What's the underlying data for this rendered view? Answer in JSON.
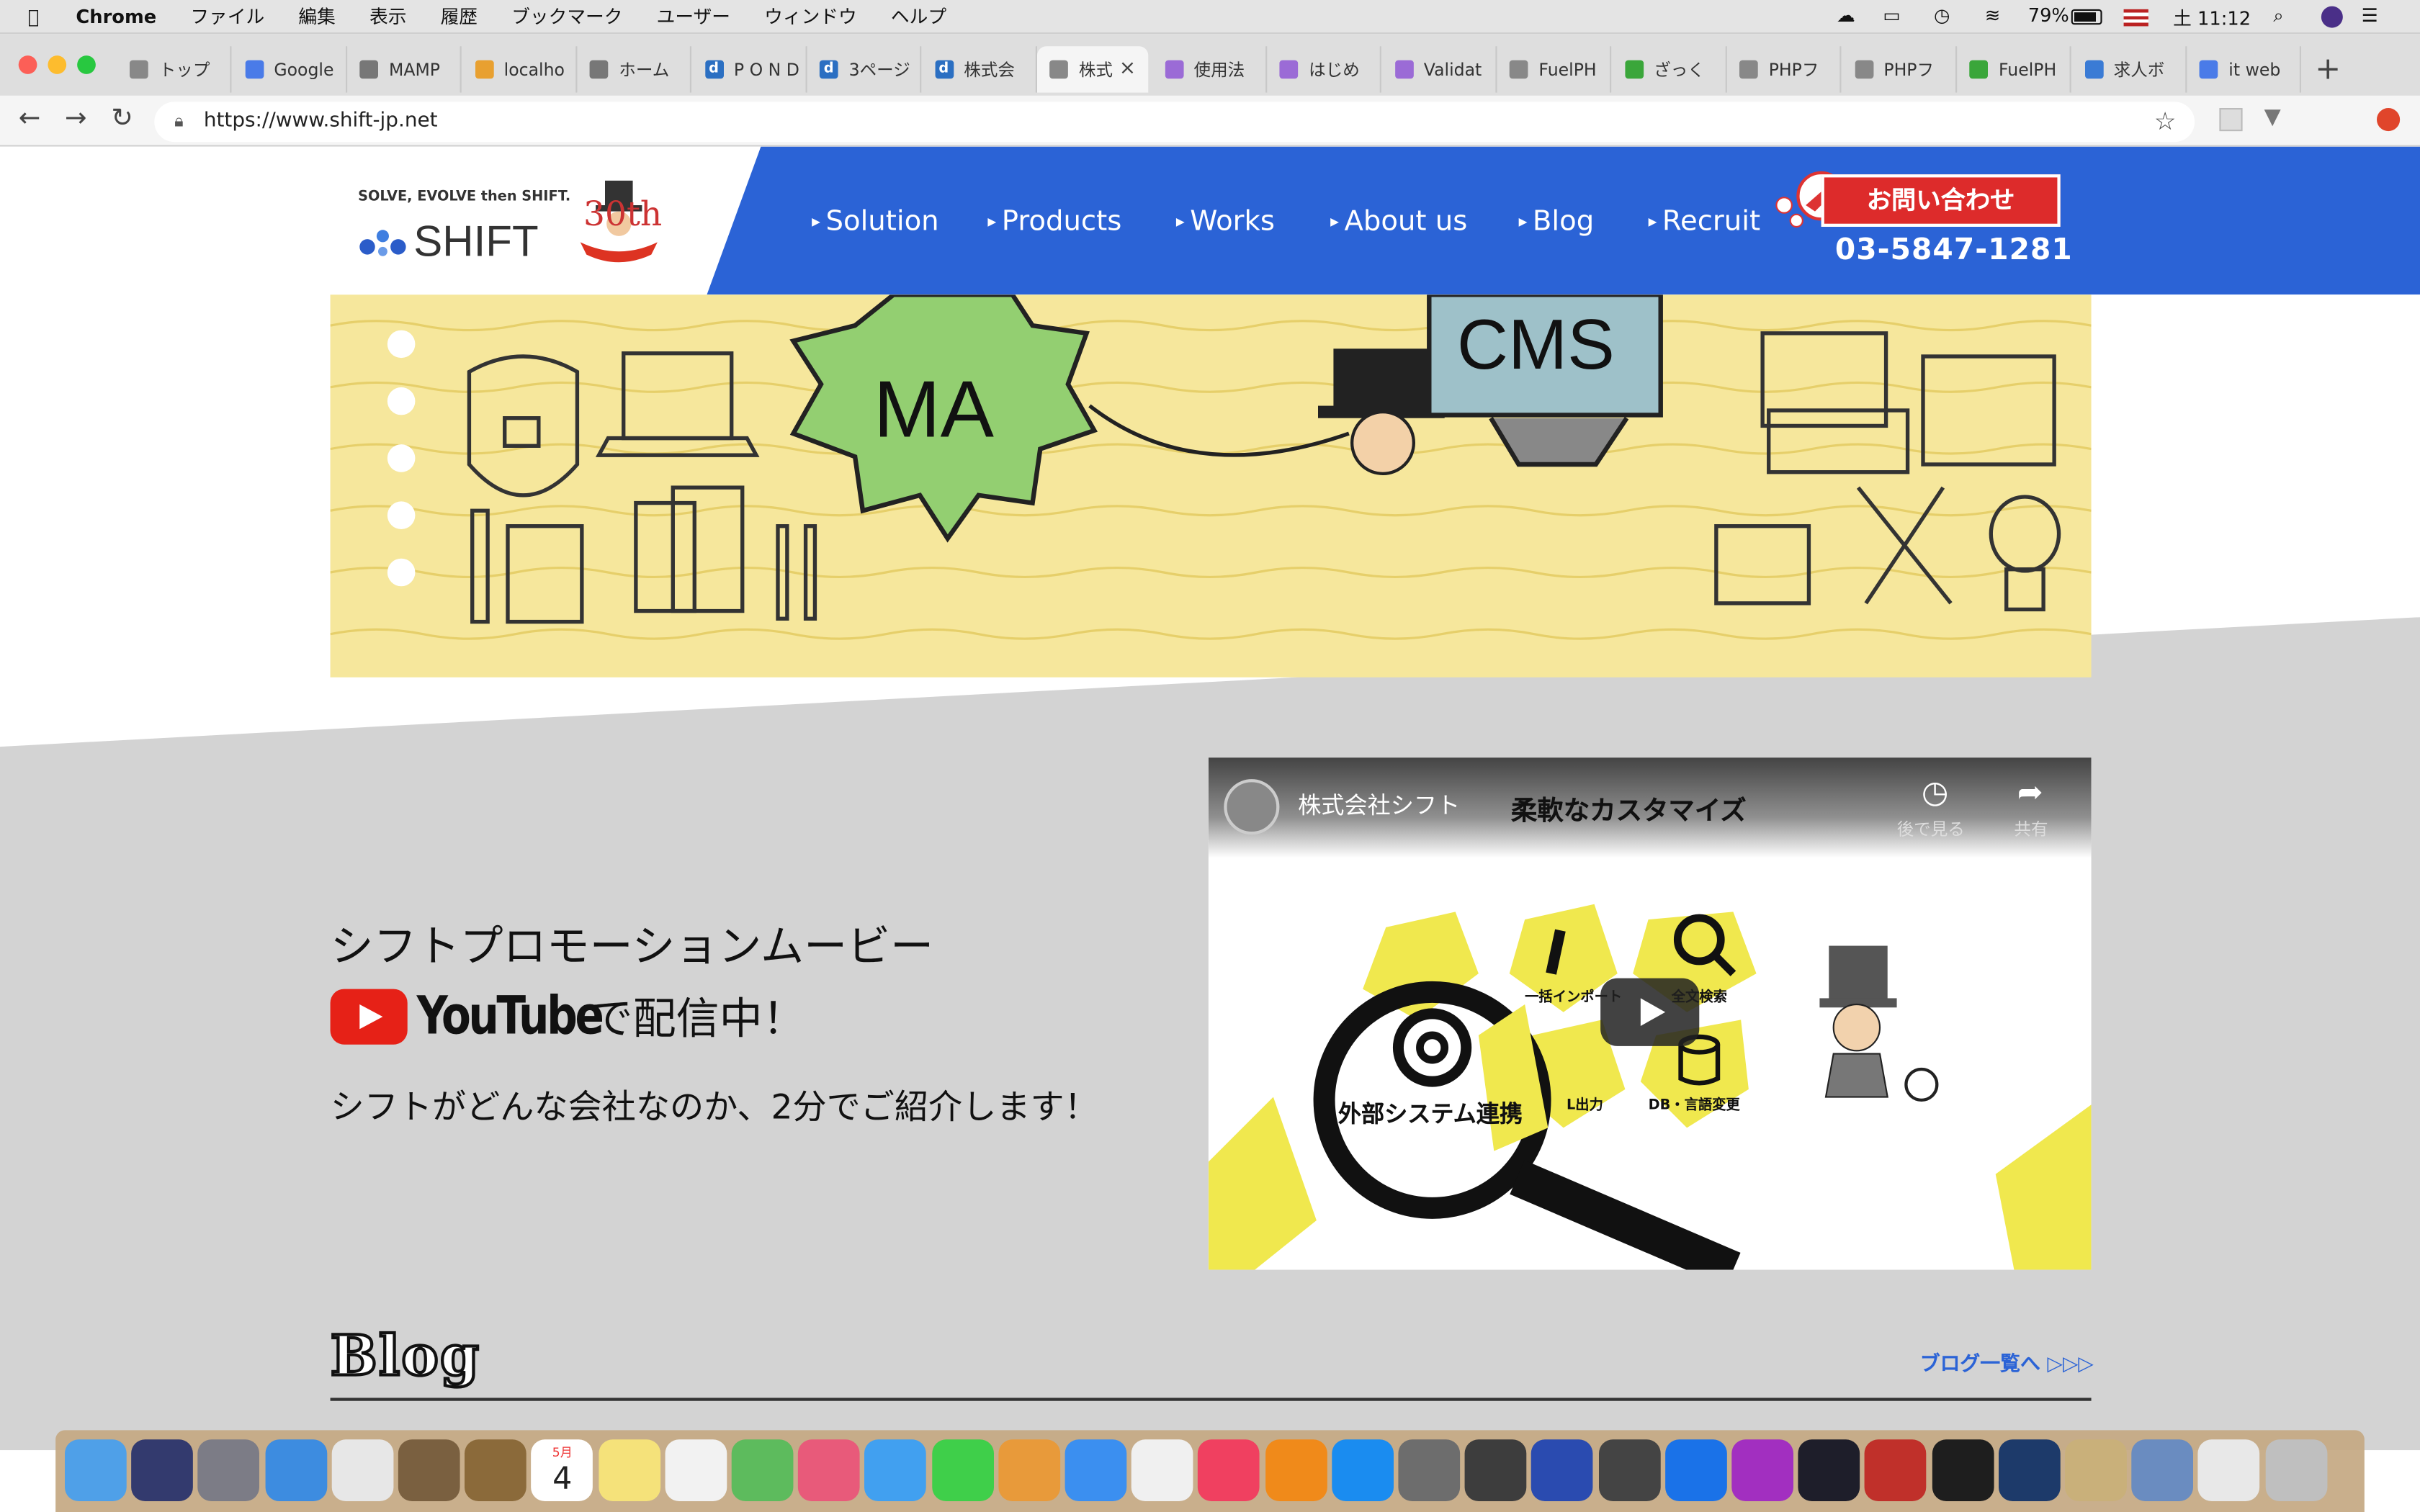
{
  "menubar": {
    "app": "Chrome",
    "items": [
      "ファイル",
      "編集",
      "表示",
      "履歴",
      "ブックマーク",
      "ユーザー",
      "ウィンドウ",
      "ヘルプ"
    ],
    "battery": "79%",
    "clock": "土 11:12"
  },
  "tabs": [
    {
      "label": "トップ",
      "fav": "doc",
      "color": "#888"
    },
    {
      "label": "Google",
      "fav": "G",
      "color": "#4a7be8"
    },
    {
      "label": "MAMP",
      "fav": "M",
      "color": "#777"
    },
    {
      "label": "localho",
      "fav": "pma",
      "color": "#e8a030"
    },
    {
      "label": "ホーム",
      "fav": "M",
      "color": "#777"
    },
    {
      "label": "P O N D",
      "fav": "d",
      "color": "#2b6fc2"
    },
    {
      "label": "3ページ",
      "fav": "d",
      "color": "#2b6fc2"
    },
    {
      "label": "株式会",
      "fav": "d",
      "color": "#2b6fc2"
    },
    {
      "label": "株式",
      "fav": "doc",
      "color": "#888",
      "active": true
    },
    {
      "label": "使用法",
      "fav": "drop",
      "color": "#9b6bd6"
    },
    {
      "label": "はじめ",
      "fav": "drop",
      "color": "#9b6bd6"
    },
    {
      "label": "Validat",
      "fav": "drop",
      "color": "#9b6bd6"
    },
    {
      "label": "FuelPH",
      "fav": "doc",
      "color": "#888"
    },
    {
      "label": "ざっく",
      "fav": "q",
      "color": "#3aa63a"
    },
    {
      "label": "PHPフ",
      "fav": "doc",
      "color": "#888"
    },
    {
      "label": "PHPフ",
      "fav": "doc",
      "color": "#888"
    },
    {
      "label": "FuelPH",
      "fav": "q",
      "color": "#3aa63a"
    },
    {
      "label": "求人ボ",
      "fav": "sq",
      "color": "#3a7bd5"
    },
    {
      "label": "it web",
      "fav": "G",
      "color": "#4a7be8"
    }
  ],
  "address": "https://www.shift-jp.net",
  "site": {
    "tagline": "SOLVE, EVOLVE then SHIFT.",
    "logo_text": "SHIFT",
    "anniv": "30th",
    "nav": [
      "Solution",
      "Products",
      "Works",
      "About us",
      "Blog",
      "Recruit"
    ],
    "contact_label": "お問い合わせ",
    "phone": "03-5847-1281"
  },
  "hero": {
    "gear_text": "MA",
    "screen_text": "CMS"
  },
  "promo": {
    "title": "シフトプロモーションムービー",
    "youtube_word": "YouTube",
    "youtube_after": "で配信中！",
    "subtitle": "シフトがどんな会社なのか、2分でご紹介します！"
  },
  "video": {
    "channel": "株式会社シフト",
    "title": "柔軟なカスタマイズ",
    "watch_later": "後で見る",
    "share": "共有",
    "labels": [
      "一括インポート",
      "全文検索",
      "外部システム連携",
      "L出力",
      "DB・言語変更"
    ]
  },
  "blog": {
    "title": "Blog",
    "link": "ブログ一覧へ ▷▷▷"
  },
  "dock": {
    "calendar_month": "5月",
    "calendar_day": "4",
    "colors": [
      "#4fa0e8",
      "#333a6e",
      "#7c7c86",
      "#3d8ce0",
      "#e7e7e7",
      "#7a6040",
      "#8b6a3a",
      "#f3f3f3",
      "#f5e27a",
      "#f2f2f2",
      "#5dbb5d",
      "#e85a7a",
      "#41a0f0",
      "#3fcf4a",
      "#e89a3a",
      "#3b8ff0",
      "#f0f0f0",
      "#f04060",
      "#f08a1a",
      "#1a8cf0",
      "#6d6d6d",
      "#3d3d3d",
      "#2a4bb0",
      "#444",
      "#1a72e8",
      "#a22fc0",
      "#1e1e2a",
      "#c0302a",
      "#1e1e1e",
      "#1d3a6a",
      "#c9b07a",
      "#6a8cc0",
      "#e8e8e8",
      "#bfbfbf"
    ]
  }
}
